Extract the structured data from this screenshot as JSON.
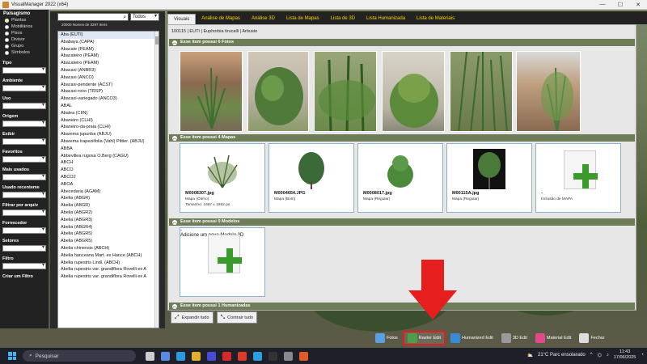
{
  "window": {
    "title": "VisualManager 2022 (x64)",
    "minimize": "—",
    "maximize": "☐",
    "close": "✕"
  },
  "left_panel": {
    "group_title": "Paisagismo",
    "options": [
      "Plantas",
      "Mobiliários",
      "Pisos",
      "Divisor",
      "Grupo",
      "Símbolos"
    ],
    "selected": "Plantas",
    "filters": [
      "Tipo",
      "Ambiente",
      "Uso",
      "Origem",
      "Exibir",
      "Favoritos",
      "Mais usados",
      "Usado recenteme",
      "Filtrar por arquiv",
      "Fornecedor",
      "Setores",
      "Filtro",
      "Criar um Filtro"
    ]
  },
  "name_panel": {
    "search_placeholder": "",
    "scope": "Todos",
    "count_text": "20000 Nomes de 3297 Itens",
    "items": [
      "Aba (EUTI)",
      "Ababaya (CAPA)",
      "Abacate (PEAM)",
      "Abacateiro (PEAM)",
      "Abacateiro (PEAM)",
      "Abacaxi (ANBR3)",
      "Abacaxi (ANCO)",
      "Abacaxi-pendente (ACST)",
      "Abacaxi-roxo (TRSP)",
      "Abacaxi-variegado (ANCO3)",
      "ABAL",
      "Abalea (CIIN)",
      "Abaneiro (CLHI)",
      "Abaneiro-da-praia (CLHI)",
      "Abarema jupunba (ABJU)",
      "Abarema trapeziifolia (Vahl) Pittier. (ABJU)",
      "ABBA",
      "Abbevillea rugosa O.Berg (CAGU)",
      "ABCH",
      "ABCO",
      "ABCO2",
      "ABOA",
      "Abecedaria (AGAM)",
      "Abelia (ABGR)",
      "Abelia (ABGR)",
      "Abelia (ABGR2)",
      "Abelia (ABGR3)",
      "Abelia (ABGR4)",
      "Abelia (ABGR5)",
      "Abelia (ABGR5)",
      "Abelia chinensis (ABCH)",
      "Abelia hanceana Mart. ex Hance (ABCH)",
      "Abelia rupestris Lindl. (ABCH)",
      "Abelia rupestris var. grandiflora Rovelli ex A",
      "Abelia rupestris var. grandiflora Rovelli ex A"
    ],
    "selected_index": 0
  },
  "tabs": [
    "Visuais",
    "Análise de Mapas",
    "Análise 3D",
    "Lista de Mapas",
    "Lista de 3D",
    "Lista Humanizada",
    "Lista de Materiais"
  ],
  "active_tab": "Visuais",
  "content": {
    "breadcrumb": "100115 | EUTI | Euphorbia tirucalli | Arbusto",
    "photos_header": "Esse item possui  6 Fotos",
    "maps_header": "Esse item possui  4 Mapas",
    "models_header": "Esse item possui  0 Modelos",
    "humanized_header": "Esse item possui  1 Humanizadas",
    "maps": [
      {
        "name": "M0008307.jpg",
        "type": "Mapa (Ótimo)",
        "size": "Tamanho: 1667 x 1952 px"
      },
      {
        "name": "M0004654.JPG",
        "type": "Mapa (Bom)",
        "size": ""
      },
      {
        "name": "M0008017.jpg",
        "type": "Mapa (Regular)",
        "size": ""
      },
      {
        "name": "M00115A.jpg",
        "type": "Mapa (Regular)",
        "size": ""
      }
    ],
    "add_map": {
      "name": "-",
      "label": "Inclusão de MAPA"
    },
    "add_model": {
      "name": "-",
      "label": "Adicione um novo Modelo 3D"
    },
    "expand_all": "Expandir tudo",
    "collapse_all": "Contrair tudo"
  },
  "bottom_toolbar": [
    {
      "label": "Fotos",
      "color": "#5aa0e0"
    },
    {
      "label": "Raster Edit",
      "color": "#4aa04a"
    },
    {
      "label": "Humanized Edit",
      "color": "#3a8ad8"
    },
    {
      "label": "3D Edit",
      "color": "#9a9a9a"
    },
    {
      "label": "Material Edit",
      "color": "#e04a8a"
    },
    {
      "label": "Fechar",
      "color": "#dddddd"
    }
  ],
  "taskbar": {
    "search_placeholder": "Pesquisar",
    "weather": "21°C  Parc ensolarado",
    "time": "11:43",
    "date": "17/06/2025"
  },
  "colors": {
    "tab_text": "#ffd700",
    "group_bar": "#6f7c58",
    "annotation": "#e61e1e"
  }
}
